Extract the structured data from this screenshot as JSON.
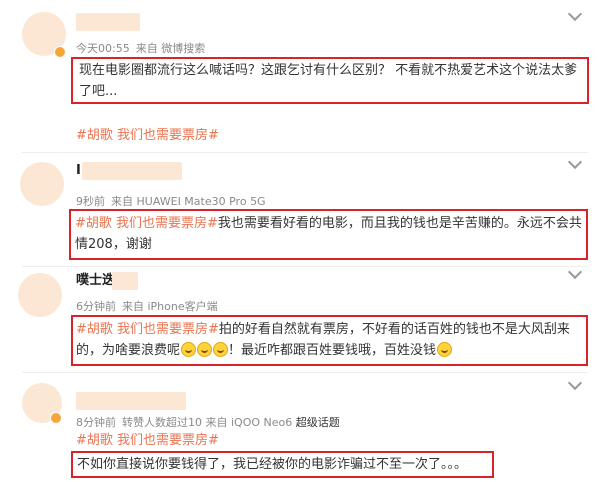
{
  "comments": [
    {
      "time": "今天00:55",
      "source": "来自 微博搜索",
      "text_line1": "现在电影圈都流行这么喊话吗？这跟乞讨有什么区别？ 不看就不热爱艺术这个说法太爹",
      "text_line2": "了吧...",
      "topic_below": "#胡歌 我们也需要票房#"
    },
    {
      "name_fragment": "I",
      "time": "9秒前",
      "source": "来自 HUAWEI Mate30 Pro 5G",
      "topic": "#胡歌 我们也需要票房#",
      "text_line1": "我也需要看好看的电影，而且我的钱也是辛苦赚的。永远不会共",
      "text_line2": "情208，谢谢"
    },
    {
      "name_fragment": "噗士迭(",
      "time": "6分钟前",
      "source": "来自 iPhone客户端",
      "topic": "#胡歌 我们也需要票房#",
      "text_line1": "拍的好看自然就有票房，不好看的话百姓的钱也不是大风刮来",
      "text_line2a": "的，为啥要浪费呢",
      "text_line2b": "！最近咋都跟百姓要钱哦，百姓没钱"
    },
    {
      "time": "8分钟前",
      "source": "转赞人数超过10 来自 iQOO Neo6 ",
      "source_link": "超级话题",
      "topic": "#胡歌 我们也需要票房#",
      "text": "不如你直接说你要钱得了，我已经被你的电影诈骗过不至一次了。。。"
    }
  ],
  "icons": {
    "chevron": "chevron-down-icon",
    "emoji": "grinning-face-icon",
    "emoji_end": "pensive-face-icon"
  },
  "colors": {
    "highlight_border": "#d9222a",
    "topic": "#eb7350",
    "meta": "#8a8a8a",
    "blur": "#fbe7d3"
  }
}
